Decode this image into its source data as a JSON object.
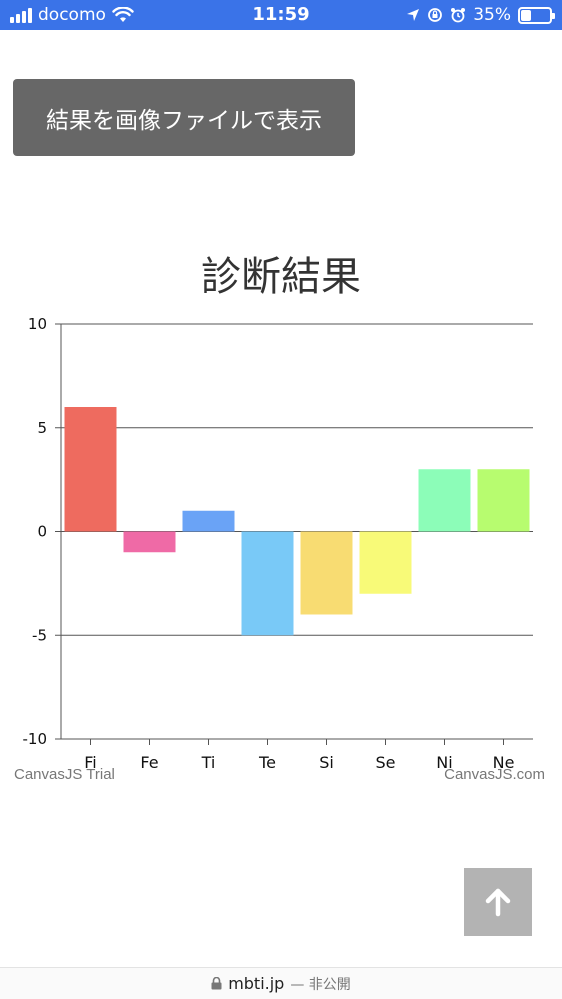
{
  "status_bar": {
    "carrier": "docomo",
    "time": "11:59",
    "battery": "35%",
    "battery_level": 0.35
  },
  "main": {
    "show_image_button": "結果を画像ファイルで表示"
  },
  "chart_data": {
    "type": "bar",
    "title": "診断結果",
    "categories": [
      "Fi",
      "Fe",
      "Ti",
      "Te",
      "Si",
      "Se",
      "Ni",
      "Ne"
    ],
    "values": [
      6,
      -1,
      1,
      -5,
      -4,
      -3,
      3,
      3
    ],
    "colors": [
      "#ee6b5f",
      "#ef6aa6",
      "#6aa3f6",
      "#79c9f7",
      "#f8dc72",
      "#f8fa78",
      "#8cfdb8",
      "#b7fc6f"
    ],
    "ylim": [
      -10,
      10
    ],
    "yticks": [
      "10",
      "5",
      "0",
      "-5",
      "-10"
    ],
    "ytick_values": [
      10,
      5,
      0,
      -5,
      -10
    ],
    "grid": true
  },
  "watermark": {
    "left": "CanvasJS Trial",
    "right": "CanvasJS.com"
  },
  "url_bar": {
    "domain": "mbti.jp",
    "note": "— 非公開"
  }
}
